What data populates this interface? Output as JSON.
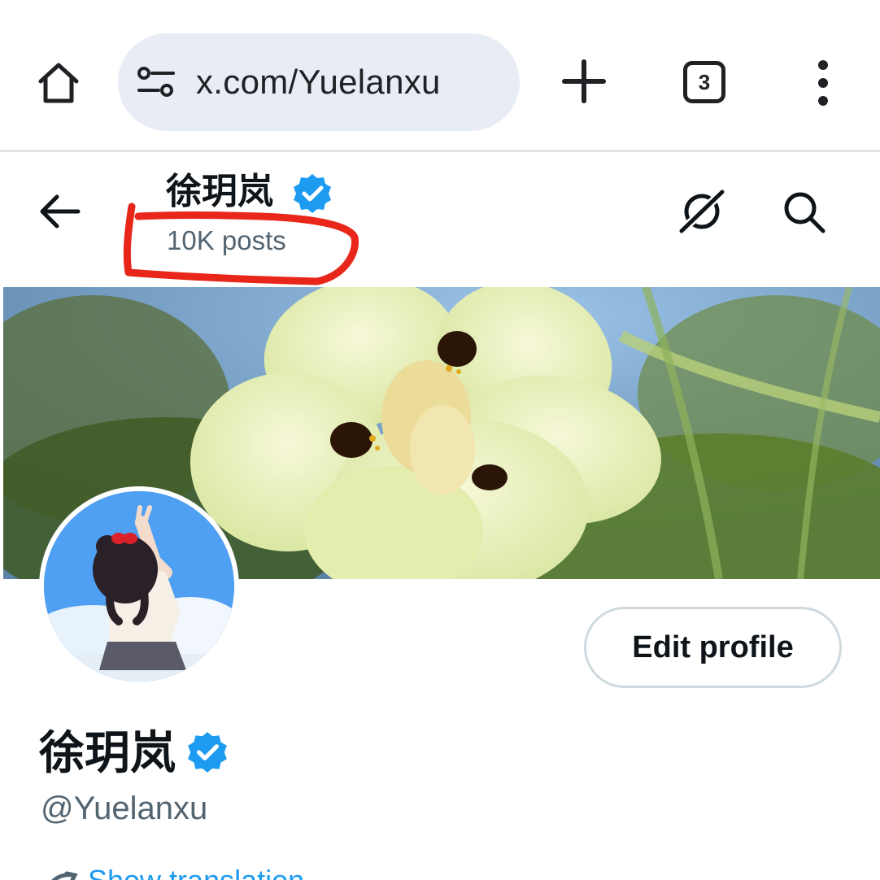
{
  "browser": {
    "url": "x.com/Yuelanxu",
    "tab_count": "3",
    "icons": {
      "home": "home-icon",
      "site_info": "tune-icon",
      "new_tab": "plus-icon",
      "tabs": "tab-switcher-icon",
      "menu": "more-vert-icon"
    }
  },
  "header": {
    "name": "徐玥岚",
    "posts": "10K posts",
    "icons": {
      "back": "arrow-left-icon",
      "grok": "grok-icon",
      "search": "search-icon",
      "verified": "verified-badge-icon"
    }
  },
  "profile": {
    "name": "徐玥岚",
    "handle": "@Yuelanxu",
    "edit_label": "Edit profile",
    "translate_label": "Show translation"
  },
  "colors": {
    "accent": "#1d9bf0",
    "text_primary": "#0f1419",
    "text_secondary": "#536471",
    "url_pill": "#e8ecf4",
    "annotation": "#e8261a",
    "button_border": "#cfd9de"
  }
}
